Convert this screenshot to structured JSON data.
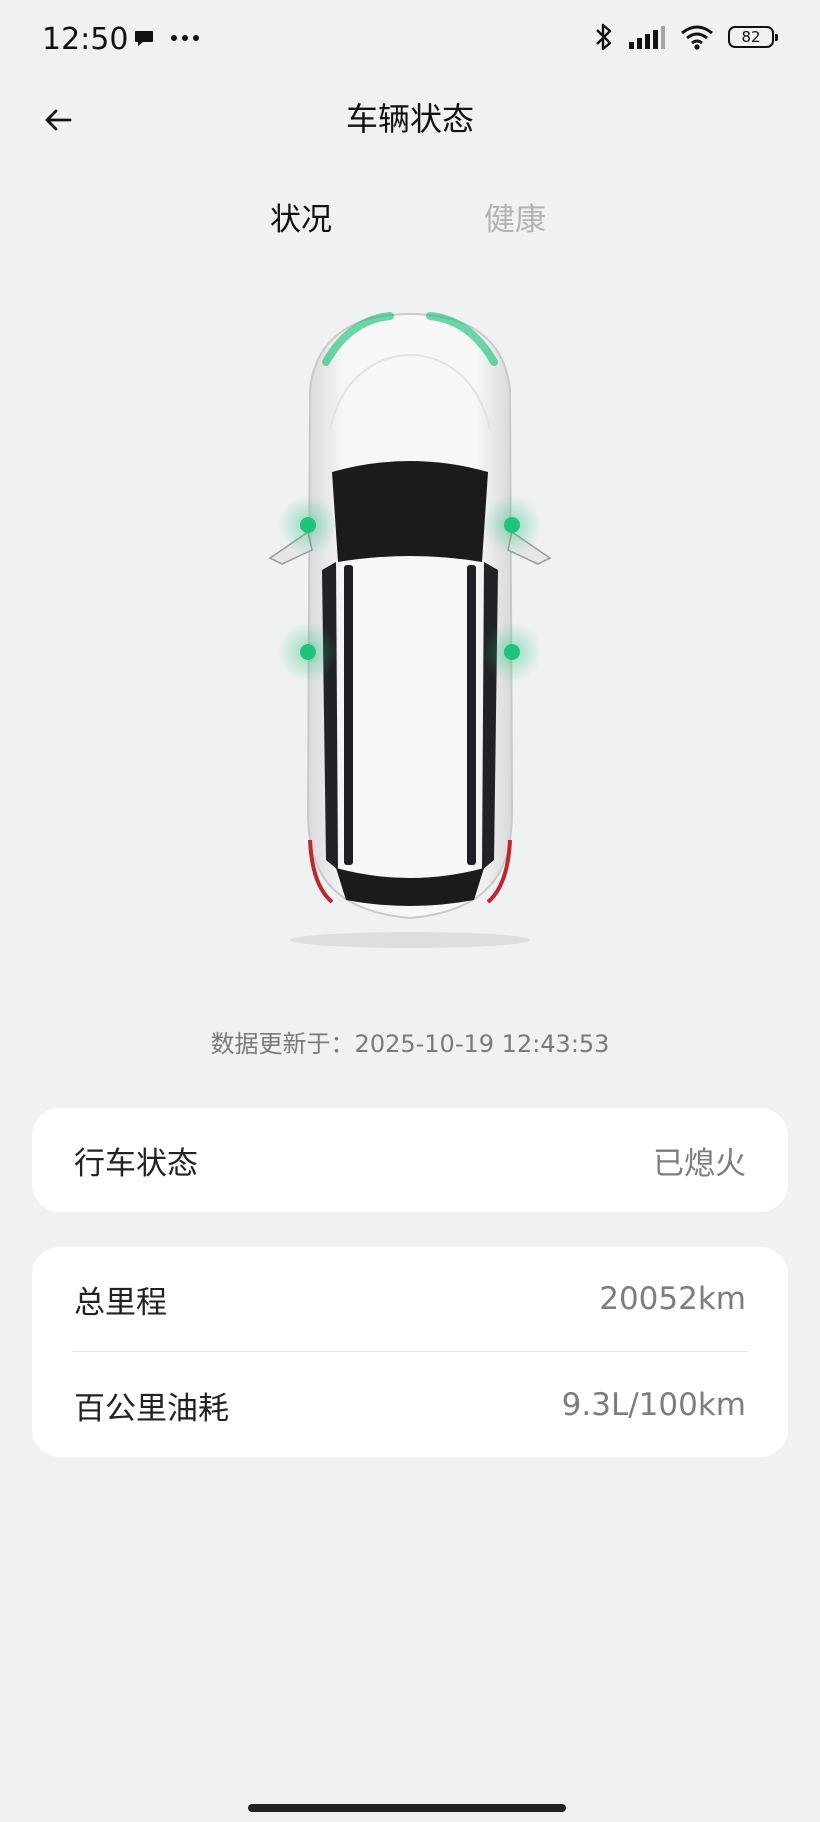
{
  "status_bar": {
    "time": "12:50",
    "battery": "82",
    "icons": [
      "chat-bubble-icon",
      "more-dots-icon",
      "bluetooth-icon",
      "signal-icon",
      "wifi-icon",
      "battery-icon"
    ]
  },
  "header": {
    "title": "车辆状态",
    "back_icon": "back-arrow-icon"
  },
  "tabs": [
    {
      "label": "状况",
      "active": true
    },
    {
      "label": "健康",
      "active": false
    }
  ],
  "vehicle": {
    "indicator_color": "#1fc47a",
    "update_label": "数据更新于：2025-10-19 12:43:53"
  },
  "driving_status": {
    "label": "行车状态",
    "value": "已熄火"
  },
  "metrics": [
    {
      "label": "总里程",
      "value": "20052km"
    },
    {
      "label": "百公里油耗",
      "value": "9.3L/100km"
    }
  ]
}
